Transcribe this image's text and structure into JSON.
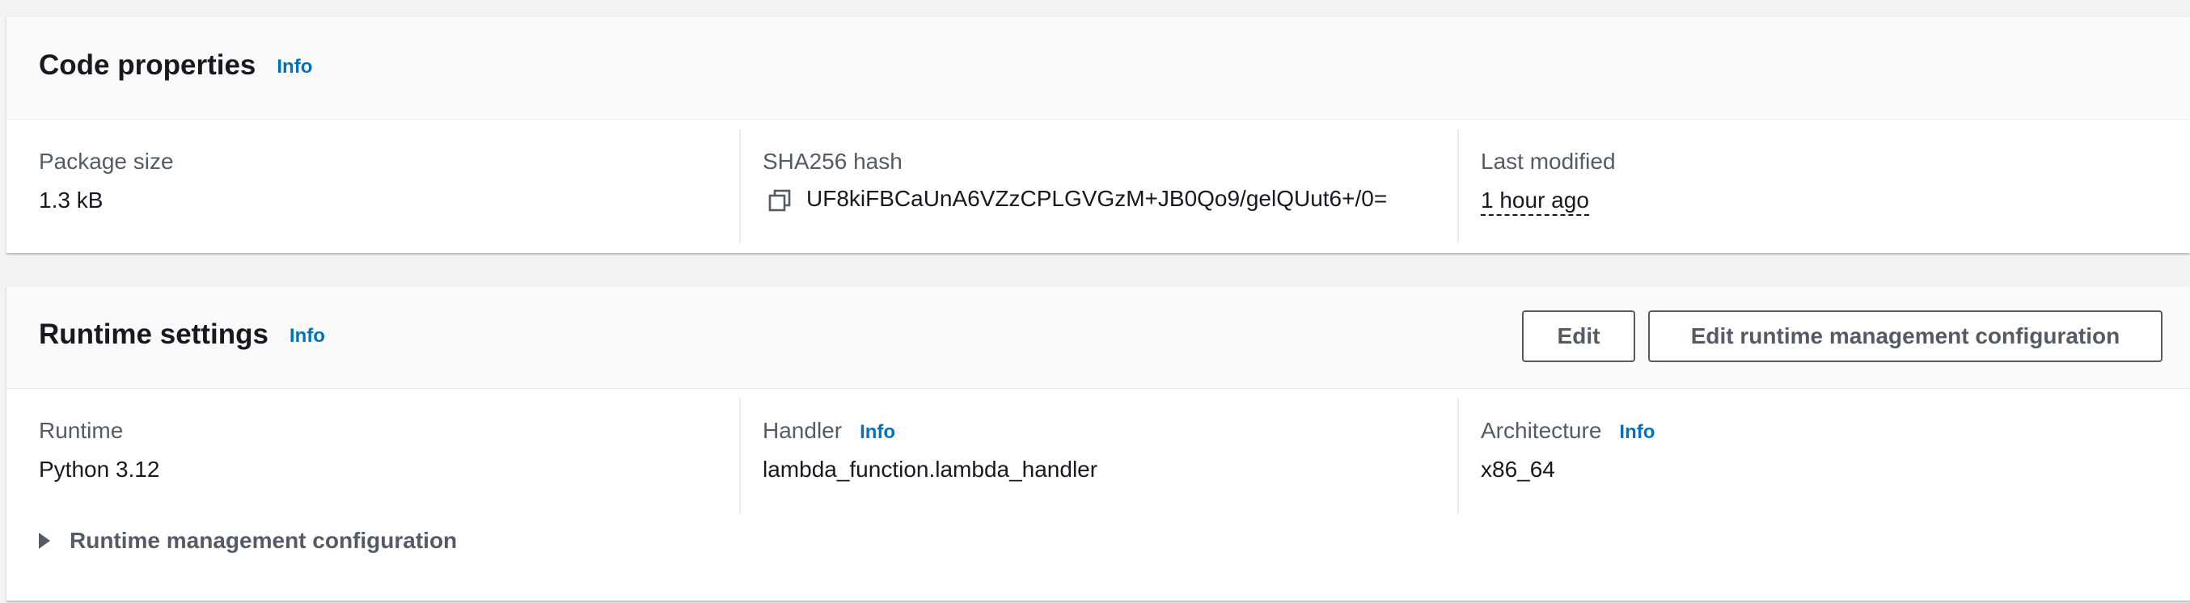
{
  "code_properties": {
    "title": "Code properties",
    "info_label": "Info",
    "package_size": {
      "label": "Package size",
      "value": "1.3 kB"
    },
    "sha256": {
      "label": "SHA256 hash",
      "value": "UF8kiFBCaUnA6VZzCPLGVGzM+JB0Qo9/gelQUut6+/0=",
      "icon": "copy-icon"
    },
    "last_modified": {
      "label": "Last modified",
      "value": "1 hour ago"
    }
  },
  "runtime_settings": {
    "title": "Runtime settings",
    "info_label": "Info",
    "edit_button": "Edit",
    "edit_runtime_mgmt_button": "Edit runtime management configuration",
    "runtime": {
      "label": "Runtime",
      "value": "Python 3.12"
    },
    "handler": {
      "label": "Handler",
      "info_label": "Info",
      "value": "lambda_function.lambda_handler"
    },
    "architecture": {
      "label": "Architecture",
      "info_label": "Info",
      "value": "x86_64"
    },
    "expander_label": "Runtime management configuration",
    "expander_icon": "caret-right-icon"
  },
  "colors": {
    "link": "#0073bb",
    "text": "#16191f",
    "label": "#545b64",
    "header_bg": "#fafafa",
    "page_bg": "#f2f3f3"
  }
}
